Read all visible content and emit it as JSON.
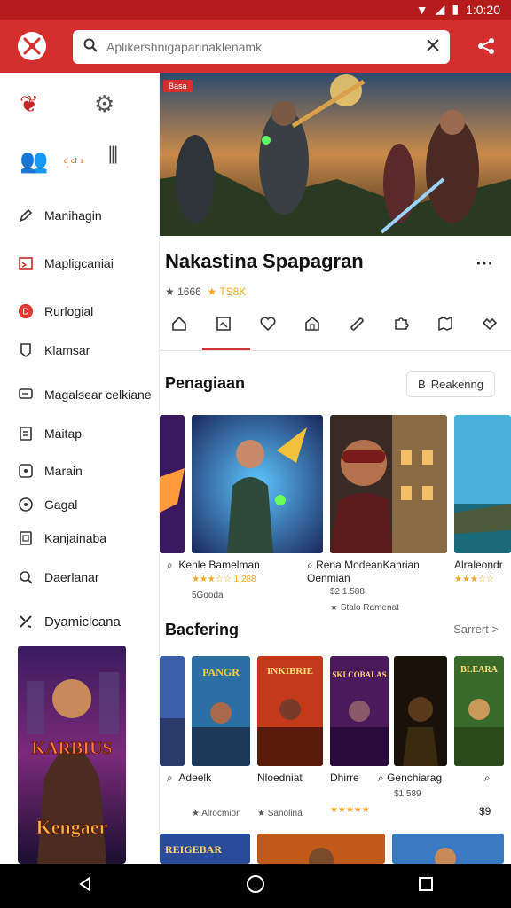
{
  "status_bar": {
    "time": "1:0:20"
  },
  "app_bar": {
    "search_placeholder": "Aplikershnigaparinaklenamk",
    "logo_icon": "crossed-tools-icon",
    "action_icon": "share-icon",
    "accent": "#d32f2f"
  },
  "sidebar": {
    "top_badge": "ᵒ᷊ ᶜᶠ ᵌ",
    "items": [
      {
        "label": "Manihagin",
        "icon": "pencil-icon"
      },
      {
        "label": "Mapligcaniai",
        "icon": "image-icon"
      },
      {
        "label": "Rurlogial",
        "icon": "red-badge-icon"
      },
      {
        "label": "Klamsar",
        "icon": "tag-icon"
      },
      {
        "label": "Magalsear celkiane",
        "icon": "chat-icon"
      },
      {
        "label": "Maitap",
        "icon": "doc-icon"
      },
      {
        "label": "Marain",
        "icon": "circle-icon"
      },
      {
        "label": "Gagal",
        "icon": "target-icon"
      },
      {
        "label": "Kanjainaba",
        "icon": "box-icon"
      },
      {
        "label": "Daerlanar",
        "icon": "search-icon"
      }
    ],
    "highlight_label": "Dyamiclcana",
    "banner": {
      "line1": "KARBIUS",
      "line2": "Kengaer"
    }
  },
  "hero": {
    "tag": "Basa"
  },
  "game": {
    "title": "Nakastina Spapagran",
    "rating_left": "★ 1666",
    "rating_right": "★ TS8K"
  },
  "section1": {
    "title": "Penagiaan",
    "button": "Reakenng",
    "cards": [
      {
        "title": "Kenle Bamelman",
        "rating": "★★★☆☆ 1,288",
        "sub": "5Gooda"
      },
      {
        "title": "Rena ModeanKanrian Oenmian",
        "rating": "$2 1.588",
        "sub": "★ Stalo Ramenat"
      },
      {
        "title": "Alraleondr",
        "rating": "★★★☆☆",
        "sub": ""
      }
    ]
  },
  "section2": {
    "title": "Bacfering",
    "see_all": "Sarrert >",
    "cards": [
      {
        "title": "Adeelk",
        "poster": "PANGR",
        "sub": "★ Alrocmion"
      },
      {
        "title": "Nloedniat",
        "poster": "INKIBRIE",
        "sub": "★ Sanolina"
      },
      {
        "title": "Dhirre",
        "poster": "SKI COBALAS",
        "sub": "★★★★★"
      },
      {
        "title": "Genchiarag",
        "poster": "",
        "sub": "$1.589"
      },
      {
        "title": "",
        "poster": "BLEARA",
        "sub": "$9"
      }
    ],
    "bottom_posters": [
      "REIGEBAR",
      "",
      ""
    ]
  }
}
